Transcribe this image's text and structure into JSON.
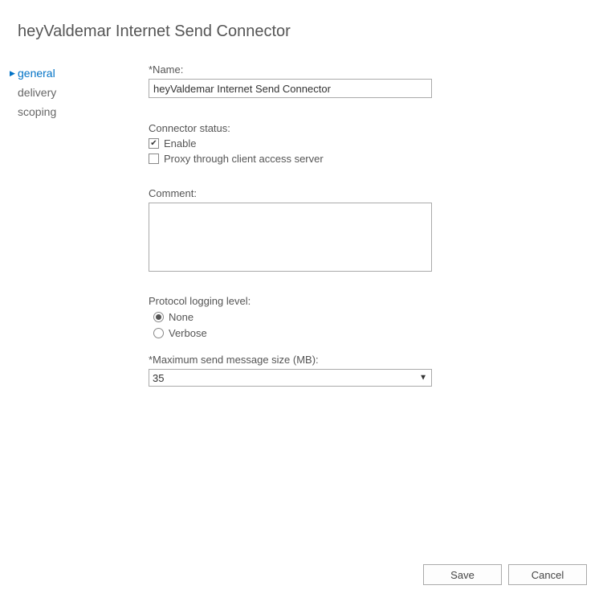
{
  "title": "heyValdemar Internet Send Connector",
  "sidebar": {
    "items": [
      {
        "label": "general",
        "active": true
      },
      {
        "label": "delivery",
        "active": false
      },
      {
        "label": "scoping",
        "active": false
      }
    ]
  },
  "form": {
    "name_label": "*Name:",
    "name_value": "heyValdemar Internet Send Connector",
    "status_label": "Connector status:",
    "enable_label": "Enable",
    "enable_checked": true,
    "proxy_label": "Proxy through client access server",
    "proxy_checked": false,
    "comment_label": "Comment:",
    "comment_value": "",
    "logging_label": "Protocol logging level:",
    "logging_options": {
      "none": "None",
      "verbose": "Verbose"
    },
    "logging_selected": "none",
    "maxsize_label": "*Maximum send message size (MB):",
    "maxsize_value": "35"
  },
  "buttons": {
    "save": "Save",
    "cancel": "Cancel"
  }
}
